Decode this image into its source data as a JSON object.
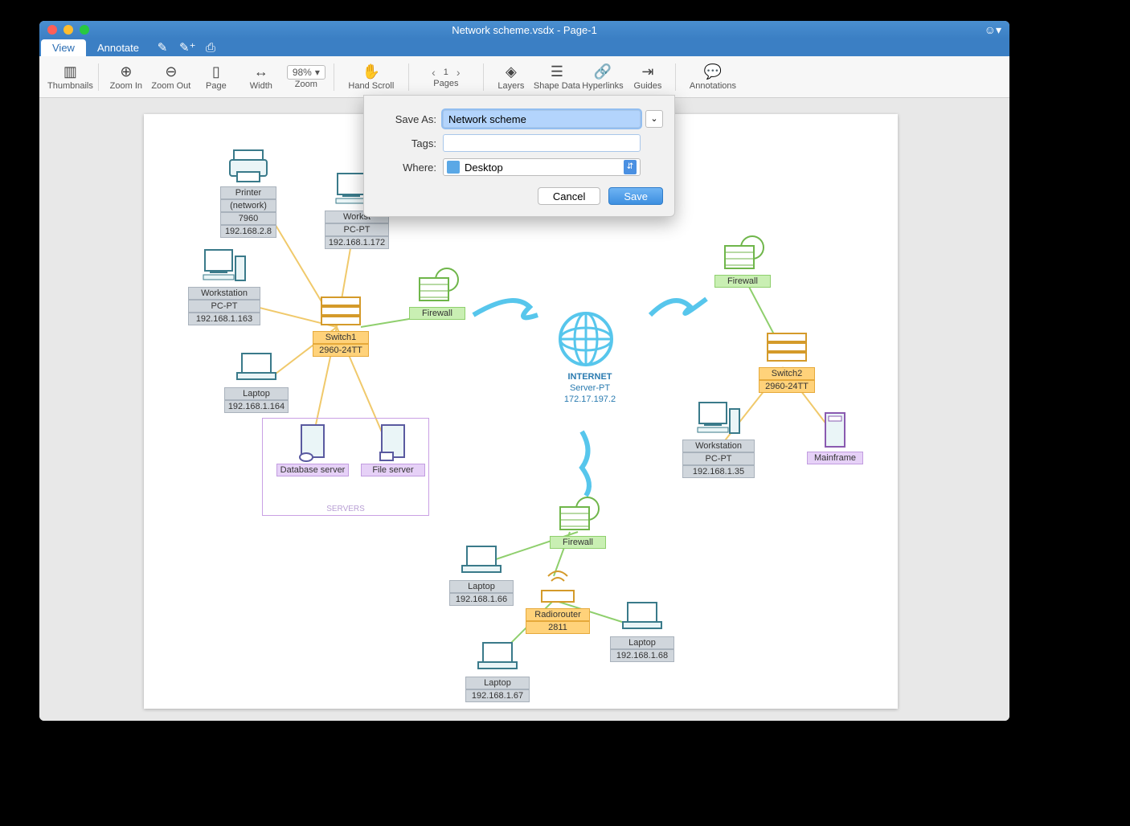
{
  "window": {
    "title": "Network scheme.vsdx - Page-1"
  },
  "tabs": {
    "view": "View",
    "annotate": "Annotate"
  },
  "toolbar": {
    "thumbnails": "Thumbnails",
    "zoomin": "Zoom In",
    "zoomout": "Zoom Out",
    "page": "Page",
    "width": "Width",
    "zoompct": "98%",
    "zoom": "Zoom",
    "handscroll": "Hand Scroll",
    "pageno": "1",
    "pages": "Pages",
    "layers": "Layers",
    "shapedata": "Shape Data",
    "hyperlinks": "Hyperlinks",
    "guides": "Guides",
    "annotations": "Annotations"
  },
  "dialog": {
    "saveas_lbl": "Save As:",
    "saveas_val": "Network scheme",
    "tags_lbl": "Tags:",
    "tags_val": "",
    "where_lbl": "Where:",
    "where_val": "Desktop",
    "cancel": "Cancel",
    "save": "Save"
  },
  "nodes": {
    "printer": {
      "l1": "Printer",
      "l2": "(network)",
      "l3": "7960",
      "l4": "192.168.2.8"
    },
    "ws1": {
      "l1": "Workst",
      "l2": "PC-PT",
      "l3": "192.168.1.172"
    },
    "ws2": {
      "l1": "Workstation",
      "l2": "PC-PT",
      "l3": "192.168.1.163"
    },
    "laptop1": {
      "l1": "Laptop",
      "l2": "192.168.1.164"
    },
    "switch1": {
      "l1": "Switch1",
      "l2": "2960-24TT"
    },
    "fw1": {
      "l1": "Firewall"
    },
    "db": {
      "l1": "Database server"
    },
    "file": {
      "l1": "File server"
    },
    "servers": "SERVERS",
    "internet": {
      "l1": "INTERNET",
      "l2": "Server-PT",
      "l3": "172.17.197.2"
    },
    "fw2": {
      "l1": "Firewall"
    },
    "switch2": {
      "l1": "Switch2",
      "l2": "2960-24TT"
    },
    "ws3": {
      "l1": "Workstation",
      "l2": "PC-PT",
      "l3": "192.168.1.35"
    },
    "mainframe": {
      "l1": "Mainframe"
    },
    "fw3": {
      "l1": "Firewall"
    },
    "radio": {
      "l1": "Radiorouter",
      "l2": "2811"
    },
    "laptop2": {
      "l1": "Laptop",
      "l2": "192.168.1.66"
    },
    "laptop3": {
      "l1": "Laptop",
      "l2": "192.168.1.67"
    },
    "laptop4": {
      "l1": "Laptop",
      "l2": "192.168.1.68"
    }
  }
}
